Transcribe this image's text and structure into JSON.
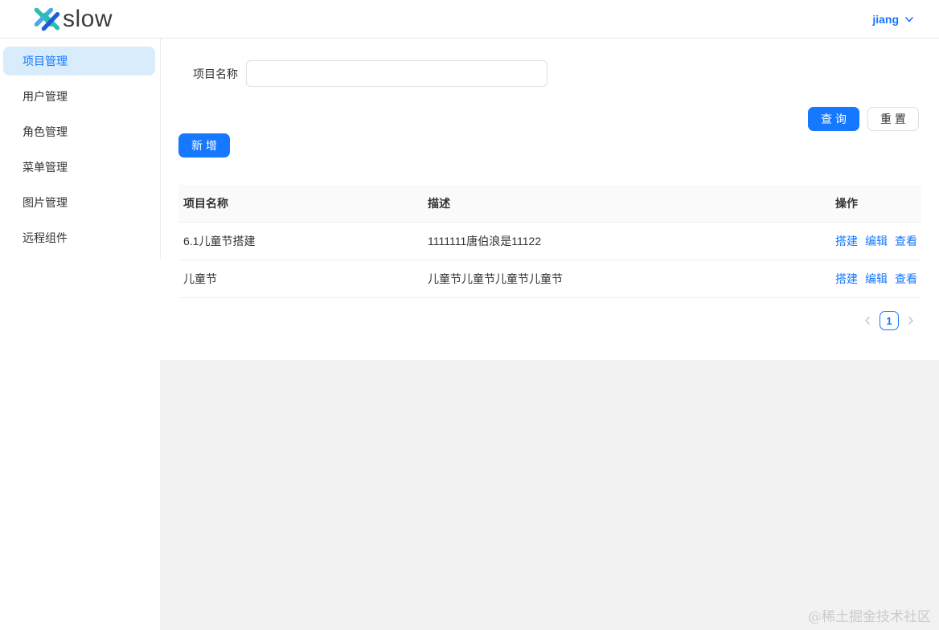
{
  "header": {
    "logo_text": "slow",
    "user_name": "jiang"
  },
  "sidebar": {
    "items": [
      {
        "label": "项目管理",
        "active": true
      },
      {
        "label": "用户管理",
        "active": false
      },
      {
        "label": "角色管理",
        "active": false
      },
      {
        "label": "菜单管理",
        "active": false
      },
      {
        "label": "图片管理",
        "active": false
      },
      {
        "label": "远程组件",
        "active": false
      }
    ]
  },
  "filter": {
    "project_name_label": "项目名称",
    "project_name_value": "",
    "search_label": "查 询",
    "reset_label": "重 置"
  },
  "toolbar": {
    "add_label": "新 增"
  },
  "table": {
    "columns": [
      "项目名称",
      "描述",
      "操作"
    ],
    "action_labels": [
      "搭建",
      "编辑",
      "查看"
    ],
    "rows": [
      {
        "name": "6.1儿童节搭建",
        "description": "1111111唐伯浪是11122"
      },
      {
        "name": "儿童节",
        "description": "儿童节儿童节儿童节儿童节"
      }
    ]
  },
  "pagination": {
    "current_page": "1"
  },
  "watermark_text": "@稀土掘金技术社区",
  "colors": {
    "primary": "#1677ff",
    "sidebar_active_bg": "#d9ecfb",
    "table_header_bg": "#fafafa",
    "panel_gray": "#f2f2f2",
    "logo_teal": "#2abfb2",
    "logo_light_blue": "#4aa8e8",
    "logo_dark_blue": "#1e5bd6"
  }
}
